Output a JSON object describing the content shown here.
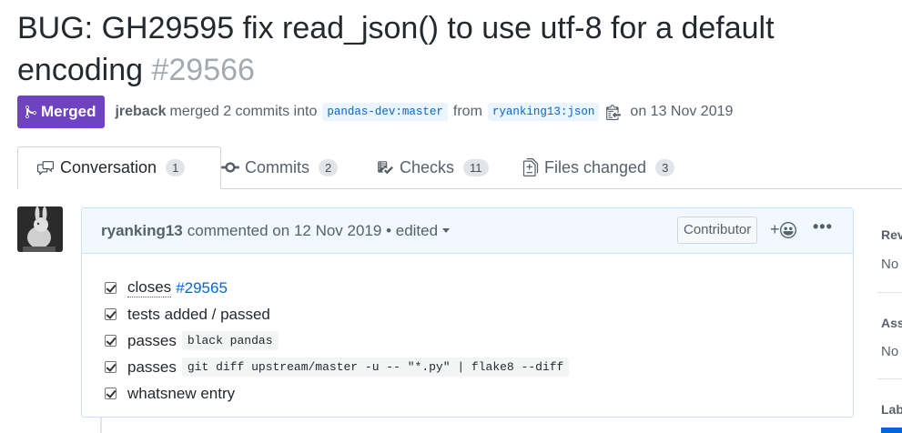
{
  "pr": {
    "title": "BUG: GH29595 fix read_json() to use utf-8 for a default encoding",
    "number": "#29566",
    "state_badge": "Merged",
    "author": "jreback",
    "merged_text": "merged 2 commits into",
    "base_branch": "pandas-dev:master",
    "from_text": "from",
    "head_branch": "ryanking13:json",
    "date_text": "on 13 Nov 2019"
  },
  "tabs": [
    {
      "label": "Conversation",
      "count": "1",
      "icon": "comment-discussion-icon"
    },
    {
      "label": "Commits",
      "count": "2",
      "icon": "git-commit-icon"
    },
    {
      "label": "Checks",
      "count": "11",
      "icon": "checklist-icon"
    },
    {
      "label": "Files changed",
      "count": "3",
      "icon": "file-diff-icon"
    }
  ],
  "comment": {
    "author": "ryanking13",
    "action": "commented on 12 Nov 2019 • edited",
    "role_badge": "Contributor",
    "react_label": "+",
    "more_label": "•••",
    "tasks": [
      {
        "text": "closes",
        "link": "#29565"
      },
      {
        "text": "tests added / passed"
      },
      {
        "text": "passes",
        "code": "black pandas"
      },
      {
        "text": "passes",
        "code": "git diff upstream/master -u -- \"*.py\" | flake8 --diff"
      },
      {
        "text": "whatsnew entry"
      }
    ]
  },
  "sidebar": {
    "reviewers_head": "Rev",
    "reviewers_val": "No",
    "assignees_head": "Ass",
    "assignees_val": "No",
    "labels_head": "Lab"
  },
  "colors": {
    "merged": "#6f42c1",
    "link": "#0366d6",
    "comment_header": "#f1f8ff"
  }
}
